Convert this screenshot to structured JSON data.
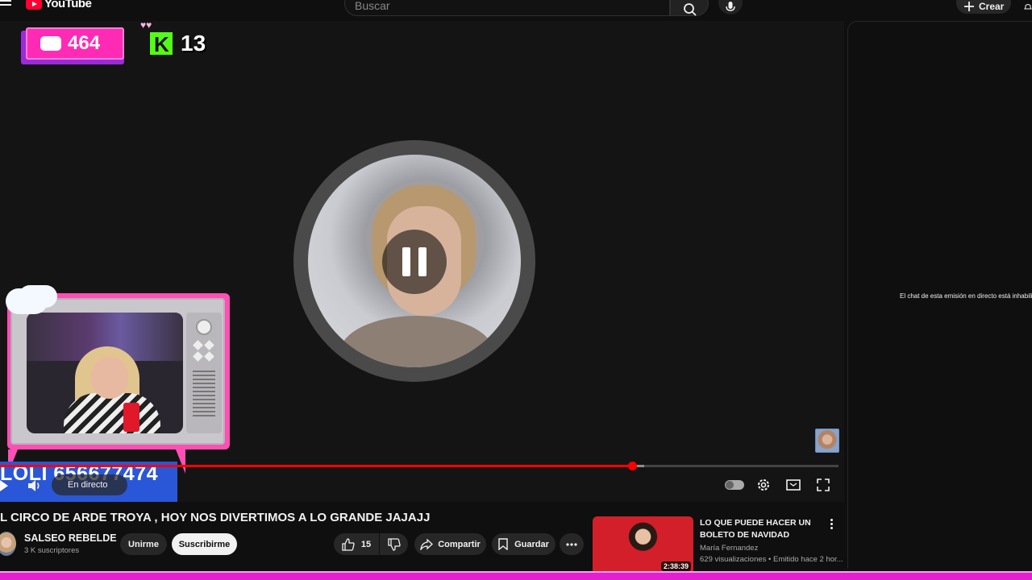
{
  "masthead": {
    "logo_text": "YouTube",
    "search_placeholder": "Buscar",
    "create_label": "Crear"
  },
  "overlays": {
    "pink_badge_count": "464",
    "kick_count": "13",
    "name_banner": "LOLI 656677474"
  },
  "player": {
    "live_label": "En directo",
    "progress_fraction": 0.754,
    "buffer_fraction": 0.768
  },
  "chat": {
    "disabled_message": "El chat de esta emisión en directo está inhabilitado."
  },
  "video": {
    "title": "L CIRCO DE ARDE TROYA , HOY NOS DIVERTIMOS A LO GRANDE JAJAJJ",
    "channel_name": "SALSEO REBELDE",
    "subscribers": "3 K suscriptores",
    "join_label": "Unirme",
    "subscribe_label": "Suscribirme",
    "like_count": "15",
    "share_label": "Compartir",
    "save_label": "Guardar"
  },
  "recommended": {
    "title": "LO QUE PUEDE HACER UN BOLETO DE NAVIDAD",
    "channel": "María Fernandez",
    "meta": "629 visualizaciones • Emitido hace 2 hor...",
    "duration": "2:38:39"
  },
  "colors": {
    "accent_red": "#ff0000",
    "overlay_pink": "#ff2bb4",
    "kick_green": "#53fc18",
    "banner_blue": "#2a57d8"
  },
  "icons": [
    "menu-icon",
    "youtube-logo-icon",
    "search-icon",
    "mic-icon",
    "plus-icon",
    "bell-icon",
    "chat-bubble-icon",
    "kick-icon",
    "pause-icon",
    "play-icon",
    "volume-icon",
    "settings-icon",
    "miniplayer-icon",
    "fullscreen-icon",
    "like-icon",
    "dislike-icon",
    "share-icon",
    "save-icon",
    "more-icon"
  ]
}
